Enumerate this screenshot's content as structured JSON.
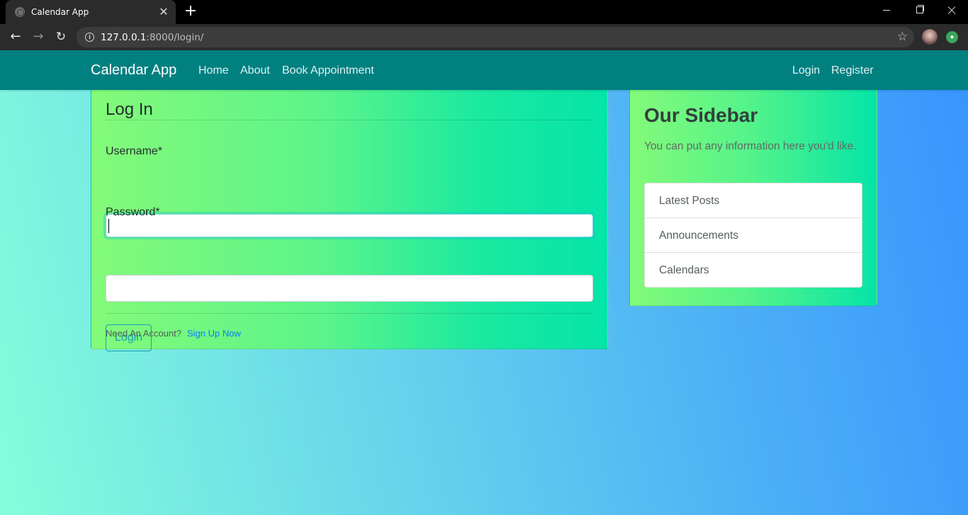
{
  "browser": {
    "tab_title": "Calendar App",
    "tab_close": "✕",
    "new_tab": "+",
    "url_host": "127.0.0.1",
    "url_path": ":8000/login/",
    "back": "←",
    "forward": "→",
    "reload": "↻",
    "bookmark": "☆",
    "info": "i"
  },
  "navbar": {
    "brand": "Calendar App",
    "links": [
      "Home",
      "About",
      "Book Appointment"
    ],
    "right_links": [
      "Login",
      "Register"
    ],
    "color": "#018080"
  },
  "login_card": {
    "heading": "Log In",
    "username_label": "Username*",
    "username_value": "",
    "password_label": "Password*",
    "password_value": "",
    "submit_label": "Login",
    "footer_text": "Need An Account?",
    "signup_link": "Sign Up Now",
    "accent": "#17a2b8"
  },
  "sidebar": {
    "title": "Our Sidebar",
    "text": "You can put any information here you'd like.",
    "items": [
      "Latest Posts",
      "Announcements",
      "Calendars"
    ]
  }
}
